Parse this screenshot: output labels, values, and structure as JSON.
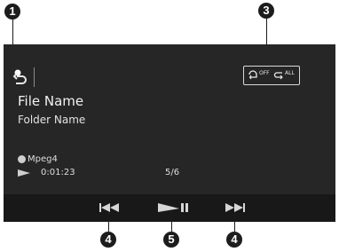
{
  "callouts": {
    "back": "1",
    "mode": "3",
    "prev": "4",
    "play": "5",
    "next": "4"
  },
  "file": {
    "name": "File Name",
    "folder": "Folder Name"
  },
  "playback": {
    "codec": "Mpeg4",
    "elapsed": "0:01:23",
    "track": "5/6"
  },
  "modes": {
    "repeat_label": "OFF",
    "shuffle_label": "ALL"
  },
  "icons": {
    "back": "back-arrow-icon",
    "repeat": "repeat-icon",
    "shuffle": "shuffle-icon",
    "prev": "skip-previous-icon",
    "play_pause": "play-pause-icon",
    "next": "skip-next-icon"
  },
  "colors": {
    "screen_bg": "#262626",
    "control_bar_bg": "#181818",
    "text": "#f2f2f2",
    "callout": "#1c1c1c"
  }
}
